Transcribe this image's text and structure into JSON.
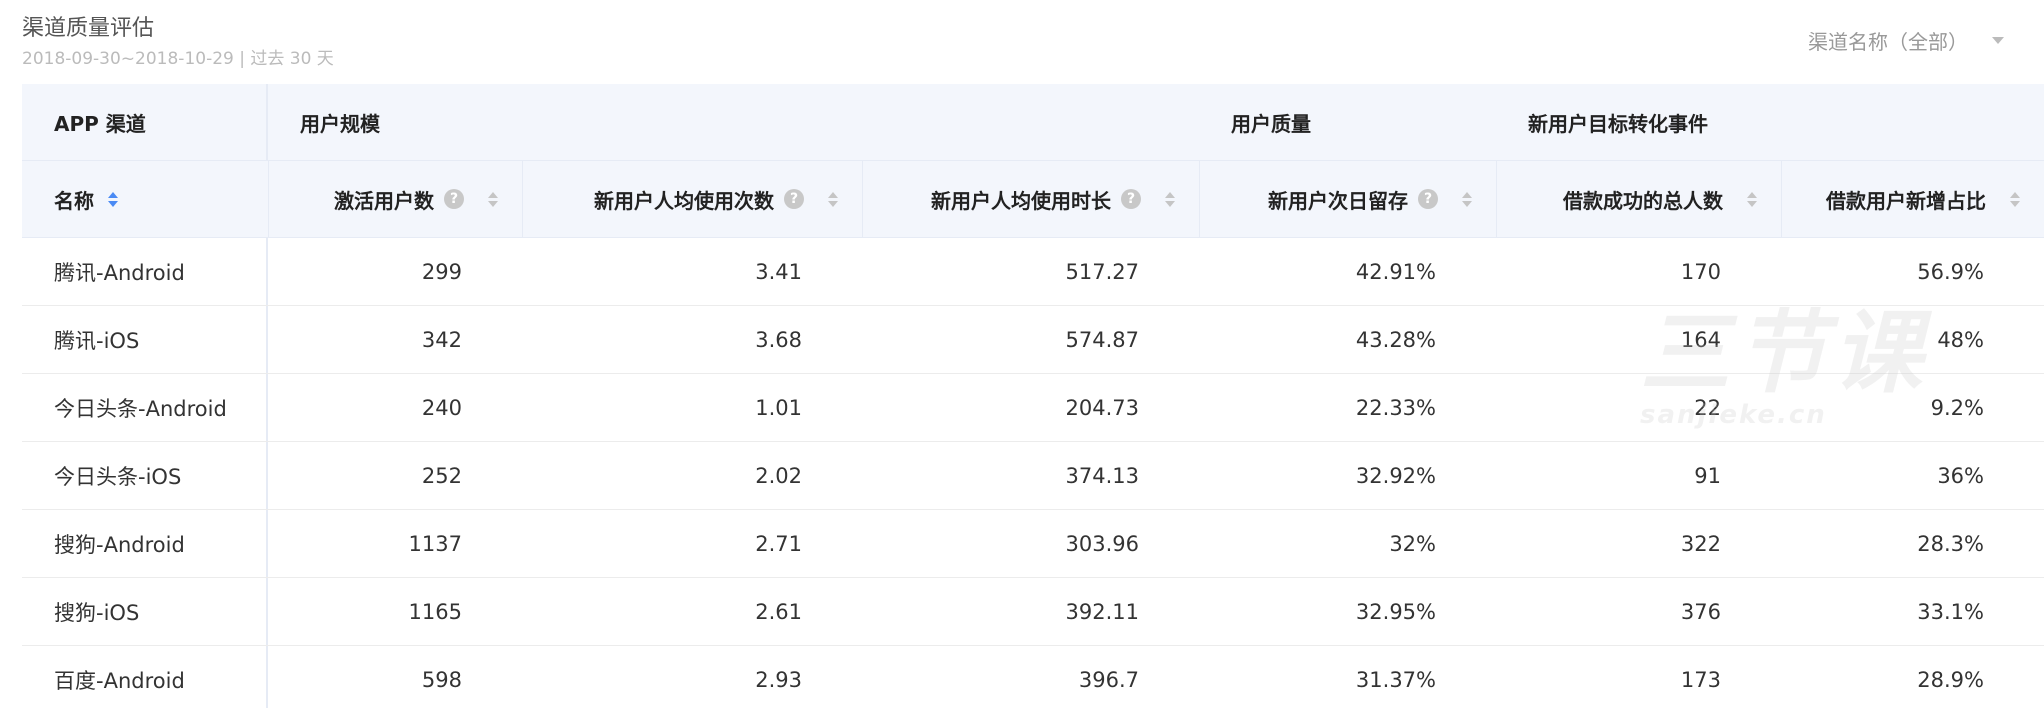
{
  "header": {
    "title": "渠道质量评估",
    "subtitle": "2018-09-30~2018-10-29 | 过去 30 天"
  },
  "filter": {
    "label": "渠道名称（全部）"
  },
  "table": {
    "groups": [
      "APP 渠道",
      "用户规模",
      "用户质量",
      "新用户目标转化事件"
    ],
    "columns": [
      "名称",
      "激活用户数",
      "新用户人均使用次数",
      "新用户人均使用时长",
      "新用户次日留存",
      "借款成功的总人数",
      "借款用户新增占比"
    ],
    "rows": [
      [
        "腾讯-Android",
        "299",
        "3.41",
        "517.27",
        "42.91%",
        "170",
        "56.9%"
      ],
      [
        "腾讯-iOS",
        "342",
        "3.68",
        "574.87",
        "43.28%",
        "164",
        "48%"
      ],
      [
        "今日头条-Android",
        "240",
        "1.01",
        "204.73",
        "22.33%",
        "22",
        "9.2%"
      ],
      [
        "今日头条-iOS",
        "252",
        "2.02",
        "374.13",
        "32.92%",
        "91",
        "36%"
      ],
      [
        "搜狗-Android",
        "1137",
        "2.71",
        "303.96",
        "32%",
        "322",
        "28.3%"
      ],
      [
        "搜狗-iOS",
        "1165",
        "2.61",
        "392.11",
        "32.95%",
        "376",
        "33.1%"
      ],
      [
        "百度-Android",
        "598",
        "2.93",
        "396.7",
        "31.37%",
        "173",
        "28.9%"
      ]
    ]
  },
  "watermark": {
    "text": "三节课",
    "url": "sanjieke.cn"
  }
}
